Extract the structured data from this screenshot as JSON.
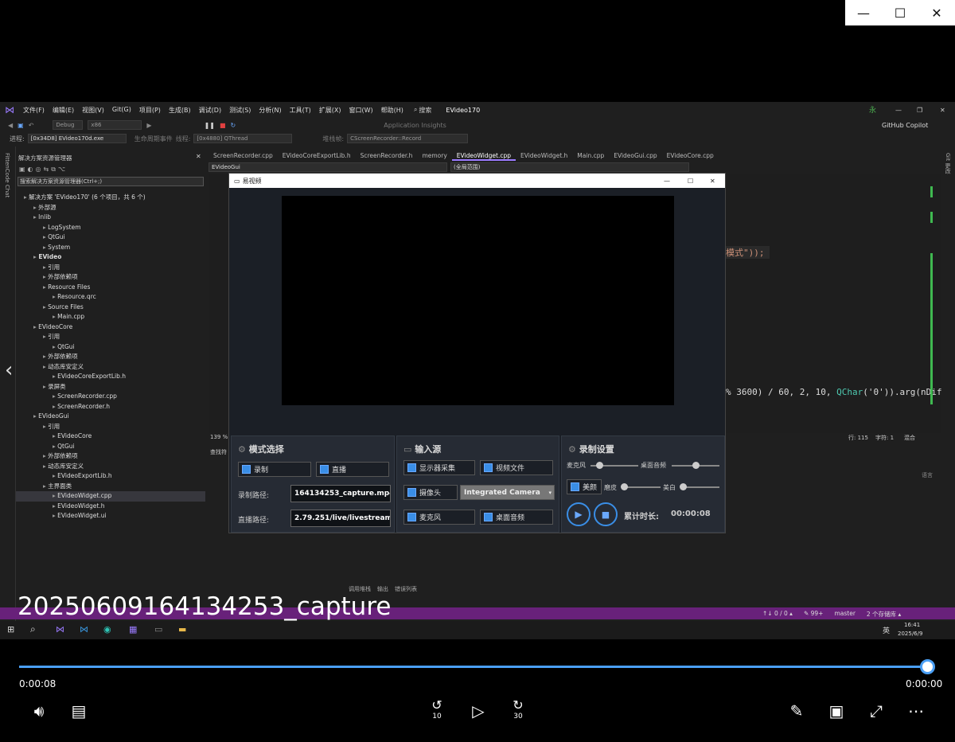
{
  "window_controls": {
    "minimize": "—",
    "maximize": "☐",
    "close": "✕"
  },
  "vs": {
    "menu": [
      "文件(F)",
      "编辑(E)",
      "视图(V)",
      "Git(G)",
      "项目(P)",
      "生成(B)",
      "调试(D)",
      "测试(S)",
      "分析(N)",
      "工具(T)",
      "扩展(X)",
      "窗口(W)",
      "帮助(H)"
    ],
    "search": "搜索",
    "app_title": "EVideo170",
    "user_initial": "永",
    "config": "Debug",
    "platform": "x86",
    "app_insights": "Application Insights",
    "copilot": "GitHub Copilot",
    "process": "[0x34D8] EVideo170d.exe",
    "lifecycle": "生命周期事件",
    "thread_label": "线程:",
    "thread": "[0x4880] QThread",
    "stack_label": "堆栈帧:",
    "stack": "CScreenRecorder::Record",
    "process_label": "进程:",
    "left_strip": "FittenCode Chat",
    "right_strip": "Git 更改",
    "sol_title": "解决方案资源管理器",
    "sol_search": "搜索解决方案资源管理器(Ctrl+;)",
    "tree": [
      {
        "label": "解决方案 'EVideo170' (6 个项目，共 6 个)",
        "indent": 0
      },
      {
        "label": "外部源",
        "indent": 1
      },
      {
        "label": "Inlib",
        "indent": 1
      },
      {
        "label": "LogSystem",
        "indent": 2
      },
      {
        "label": "QtGui",
        "indent": 2
      },
      {
        "label": "System",
        "indent": 2
      },
      {
        "label": "EVideo",
        "indent": 1,
        "bold": true
      },
      {
        "label": "引用",
        "indent": 2
      },
      {
        "label": "外部依赖项",
        "indent": 2
      },
      {
        "label": "Resource Files",
        "indent": 2
      },
      {
        "label": "Resource.qrc",
        "indent": 3
      },
      {
        "label": "Source Files",
        "indent": 2
      },
      {
        "label": "Main.cpp",
        "indent": 3
      },
      {
        "label": "EVideoCore",
        "indent": 1
      },
      {
        "label": "引用",
        "indent": 2
      },
      {
        "label": "QtGui",
        "indent": 3
      },
      {
        "label": "外部依赖项",
        "indent": 2
      },
      {
        "label": "动态库安定义",
        "indent": 2
      },
      {
        "label": "EVideoCoreExportLib.h",
        "indent": 3
      },
      {
        "label": "录屏类",
        "indent": 2
      },
      {
        "label": "ScreenRecorder.cpp",
        "indent": 3
      },
      {
        "label": "ScreenRecorder.h",
        "indent": 3
      },
      {
        "label": "EVideoGui",
        "indent": 1
      },
      {
        "label": "引用",
        "indent": 2
      },
      {
        "label": "EVideoCore",
        "indent": 3
      },
      {
        "label": "QtGui",
        "indent": 3
      },
      {
        "label": "外部依赖项",
        "indent": 2
      },
      {
        "label": "动态库安定义",
        "indent": 2
      },
      {
        "label": "EVideoExportLib.h",
        "indent": 3
      },
      {
        "label": "主界面类",
        "indent": 2
      },
      {
        "label": "EVideoWidget.cpp",
        "indent": 3,
        "selected": true
      },
      {
        "label": "EVideoWidget.h",
        "indent": 3
      },
      {
        "label": "EVideoWidget.ui",
        "indent": 3
      }
    ],
    "tabs": [
      {
        "label": "ScreenRecorder.cpp"
      },
      {
        "label": "EVideoCoreExportLib.h"
      },
      {
        "label": "ScreenRecorder.h"
      },
      {
        "label": "memory"
      },
      {
        "label": "EVideoWidget.cpp",
        "active": true
      },
      {
        "label": "EVideoWidget.h"
      },
      {
        "label": "Main.cpp"
      },
      {
        "label": "EVideoGui.cpp"
      },
      {
        "label": "EVideoCore.cpp"
      }
    ],
    "nav_scope": "EVideoGui",
    "nav_member": "(全局范围)",
    "code_line1": "模式\"));",
    "code_line2_a": "% 3600) / 60, 2, 10, ",
    "code_line2_b": "QChar",
    "code_line2_c": "('0')).arg(nDif",
    "zoom": "139 %",
    "row": "行: 115",
    "col": "字符: 1",
    "eol": "混合",
    "find_label": "查找符",
    "language_label": "语言",
    "bottom_tabs": [
      "调用堆栈",
      "输出",
      "错误列表"
    ],
    "status_items": [
      "↑↓ 0 / 0 ▴",
      "✎ 99+",
      "master",
      "2 个存储库 ▴"
    ],
    "clock_time": "16:41",
    "clock_date": "2025/6/9",
    "ime": "英"
  },
  "dialog": {
    "title": "易视频",
    "mode_title": "模式选择",
    "record": "录制",
    "live": "直播",
    "record_path_label": "录制路径:",
    "record_path": "164134253_capture.mp4",
    "live_path_label": "直播路径:",
    "live_path": "2.79.251/live/livestream",
    "input_title": "输入源",
    "display_capture": "显示器采集",
    "video_file": "视频文件",
    "camera": "摄像头",
    "camera_device": "Integrated Camera",
    "mic": "麦克风",
    "desktop_audio": "桌面音频",
    "rec_title": "录制设置",
    "mic_label": "麦克风",
    "desktop_label": "桌面音频",
    "beauty": "美颜",
    "smooth": "磨皮",
    "whiten": "美白",
    "duration_label": "累计时长:",
    "duration": "00:00:08",
    "mic_level": 0.18,
    "desktop_level": 0.5,
    "smooth_level": 0.04,
    "whiten_level": 0.05
  },
  "player": {
    "caption": "20250609164134253_capture",
    "elapsed": "0:00:08",
    "remaining": "0:00:00",
    "progress": 1.0,
    "rewind": "10",
    "forward": "30"
  }
}
